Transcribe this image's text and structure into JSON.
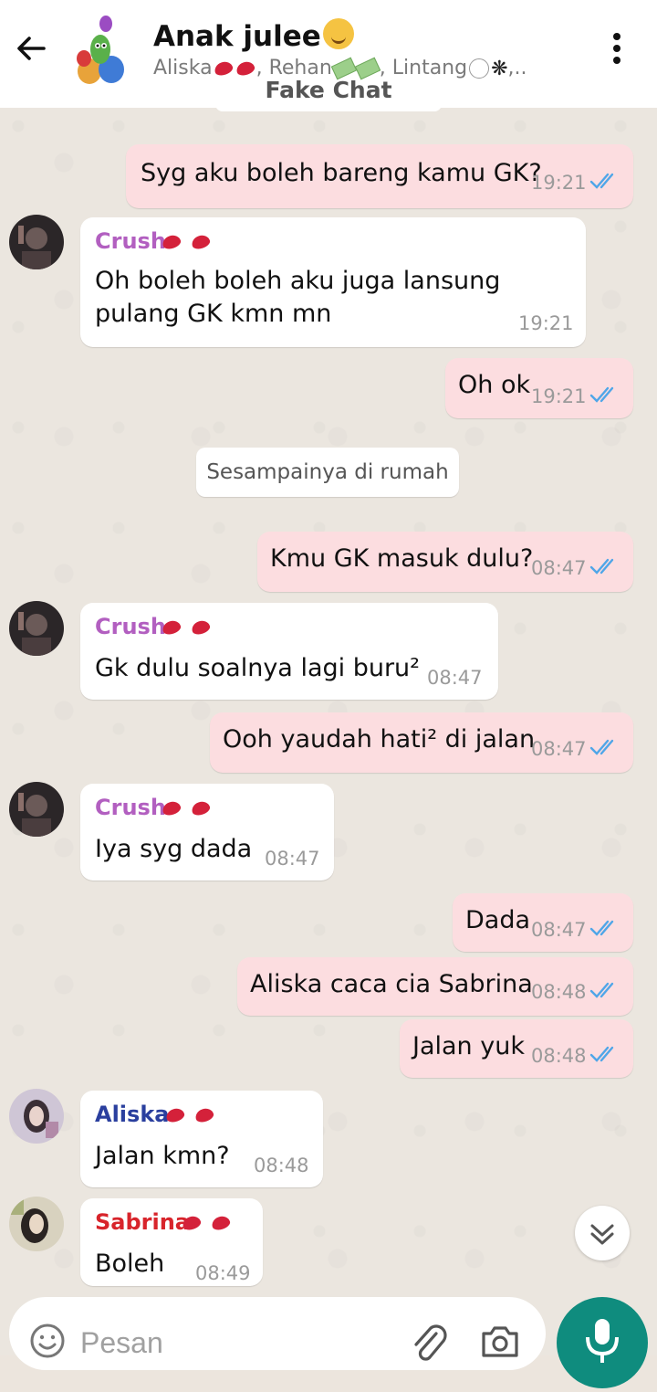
{
  "header": {
    "title": "Anak julee",
    "members": [
      {
        "name": "Aliska",
        "emoji": "kiss-mark"
      },
      {
        "name": ", Rehan",
        "emoji": "money-wings"
      },
      {
        "name": ", Lintang",
        "emoji": "spider-web"
      }
    ],
    "members_suffix": ",..",
    "watermark": "Fake Chat"
  },
  "messages": [
    {
      "dir": "out",
      "text": "Syg aku boleh bareng kamu GK?",
      "time": "19:21"
    },
    {
      "dir": "in",
      "sender": "Crush",
      "text": "Oh boleh boleh aku juga lansung",
      "text2": "pulang GK kmn mn",
      "time": "19:21"
    },
    {
      "dir": "out",
      "text": "Oh ok",
      "time": "19:21"
    },
    {
      "dir": "date",
      "text": "Sesampainya di rumah"
    },
    {
      "dir": "out",
      "text": "Kmu GK masuk dulu?",
      "time": "08:47"
    },
    {
      "dir": "in",
      "sender": "Crush",
      "text": "Gk dulu soalnya lagi buru²",
      "time": "08:47"
    },
    {
      "dir": "out",
      "text": "Ooh yaudah hati² di jalan",
      "time": "08:47"
    },
    {
      "dir": "in",
      "sender": "Crush",
      "text": "Iya syg dada",
      "time": "08:47"
    },
    {
      "dir": "out",
      "text": "Dada",
      "time": "08:47"
    },
    {
      "dir": "out",
      "text": "Aliska caca cia Sabrina",
      "time": "08:48"
    },
    {
      "dir": "out",
      "text": "Jalan yuk",
      "time": "08:48"
    },
    {
      "dir": "in",
      "sender": "Aliska",
      "text": "Jalan kmn?",
      "time": "08:48"
    },
    {
      "dir": "in",
      "sender": "Sabrina",
      "text": "Boleh",
      "time": "08:49"
    }
  ],
  "sender_colors": {
    "Crush": "#b25fc0",
    "Aliska": "#2a3f9e",
    "Sabrina": "#d8242b"
  },
  "composer": {
    "placeholder": "Pesan"
  },
  "colors": {
    "outgoing_bubble": "#fcdde0",
    "incoming_bubble": "#ffffff",
    "tick_blue": "#4fa6e8",
    "mic_button": "#0f8c7e"
  }
}
